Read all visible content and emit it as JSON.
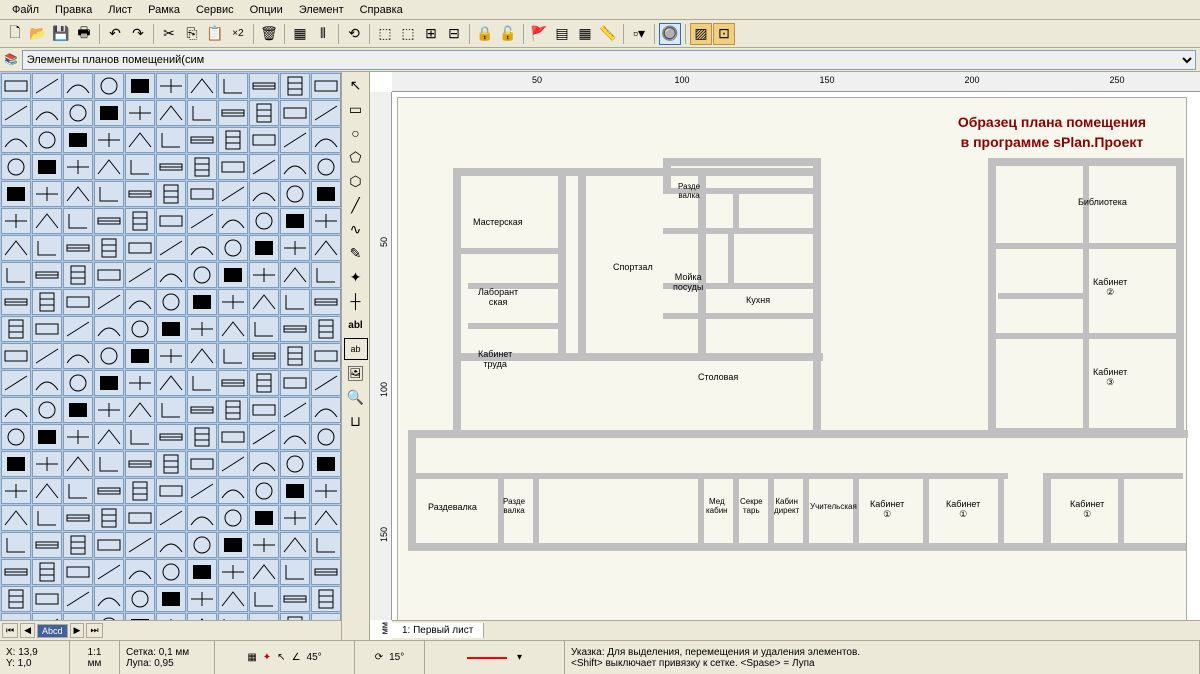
{
  "menu": [
    "Файл",
    "Правка",
    "Лист",
    "Рамка",
    "Сервис",
    "Опции",
    "Элемент",
    "Справка"
  ],
  "library_selector": "Элементы планов помещений(сим",
  "sheet_tab": "1: Первый лист",
  "ruler_h": [
    "50",
    "100",
    "150",
    "200",
    "250"
  ],
  "ruler_v": [
    "50",
    "100",
    "150"
  ],
  "ruler_v_unit": "мм",
  "plan": {
    "title_line1": "Образец плана помещения",
    "title_line2": "в программе sPlan.Проект",
    "rooms": {
      "workshop": "Мастерская",
      "lab": "Лаборант\nская",
      "cabinet_truda": "Кабинет\nтруда",
      "locker": "Раздевалка",
      "locker2": "Разде\nвалка",
      "locker3": "Разде\nвалка",
      "gym": "Спортзал",
      "dishwash": "Мойка\nпосуды",
      "kitchen": "Кухня",
      "dining": "Столовая",
      "med": "Мед\nкабин",
      "secretary": "Секре\nтарь",
      "director": "Кабин\nдирект",
      "teachers": "Учительская",
      "cabinet": "Кабинет",
      "cabinet1": "Кабинет\n①",
      "cabinet2": "Кабинет\n②",
      "cabinet3": "Кабинет\n③",
      "library": "Библиотека"
    }
  },
  "status": {
    "coords_x": "X: 13,9",
    "coords_y": "Y: 1,0",
    "scale": "1:1",
    "scale_unit": "мм",
    "grid": "Сетка: 0,1 мм",
    "zoom": "Лупа: 0,95",
    "angle1": "45°",
    "angle2": "15°",
    "hint1": "Указка: Для выделения, перемещения и удаления элементов.",
    "hint2": "<Shift> выключает привязку к сетке. <Spase> = Лупа"
  },
  "tool_x2": "×2"
}
